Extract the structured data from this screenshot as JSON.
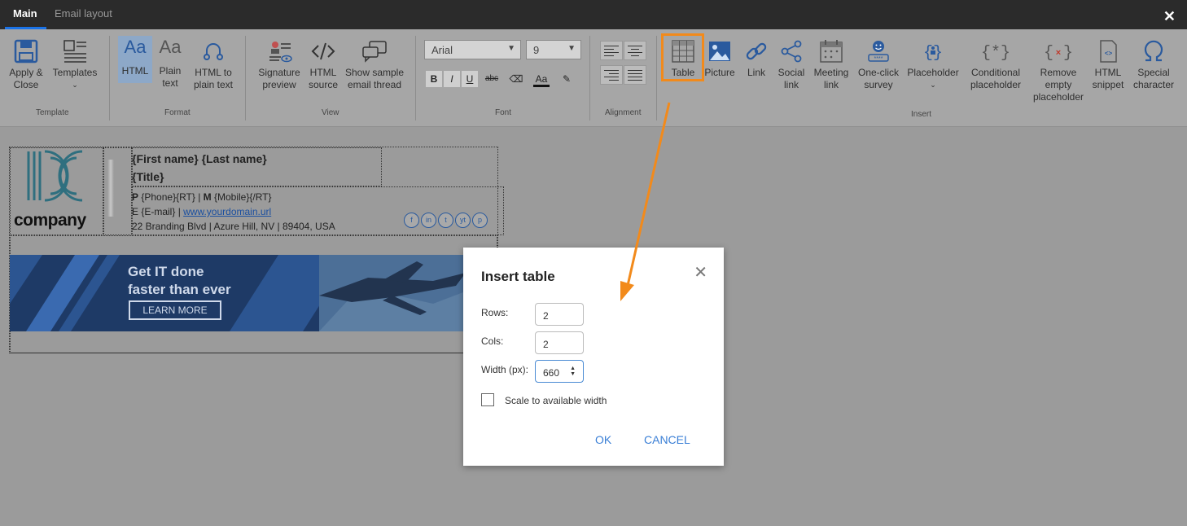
{
  "tabs": [
    {
      "label": "Main",
      "active": true
    },
    {
      "label": "Email layout",
      "active": false
    }
  ],
  "ribbon": {
    "groups": {
      "template": "Template",
      "format": "Format",
      "view": "View",
      "font": "Font",
      "alignment": "Alignment",
      "insert": "Insert"
    },
    "buttons": {
      "apply_close": [
        "Apply &",
        "Close"
      ],
      "templates": "Templates",
      "html": "HTML",
      "plain_text": [
        "Plain",
        "text"
      ],
      "html_to_plain": [
        "HTML to",
        "plain text"
      ],
      "signature_preview": [
        "Signature",
        "preview"
      ],
      "html_source": [
        "HTML",
        "source"
      ],
      "sample_thread": [
        "Show sample",
        "email thread"
      ],
      "table": "Table",
      "picture": "Picture",
      "link": "Link",
      "social_link": [
        "Social",
        "link"
      ],
      "meeting_link": [
        "Meeting",
        "link"
      ],
      "survey": [
        "One-click",
        "survey"
      ],
      "placeholder": "Placeholder",
      "conditional": [
        "Conditional",
        "placeholder"
      ],
      "remove_empty": [
        "Remove",
        "empty",
        "placeholder"
      ],
      "html_snippet": [
        "HTML",
        "snippet"
      ],
      "special_char": [
        "Special",
        "character"
      ]
    },
    "font": {
      "family": "Arial",
      "size": "9"
    },
    "format_buttons": [
      "B",
      "I",
      "U",
      "abc",
      "Aa"
    ]
  },
  "signature": {
    "name_line": "{First name} {Last name}",
    "title_line": "{Title}",
    "phone_prefix": "P",
    "phone_value": "{Phone}{RT} | ",
    "mobile_prefix": "M",
    "mobile_value": "{Mobile}{/RT}",
    "email_line": "E {E-mail} | ",
    "url": "www.yourdomain.url",
    "address": "22 Branding Blvd | Azure Hill, NV | 89404, USA",
    "logo_text": "company",
    "socials": [
      "f",
      "in",
      "t",
      "yt",
      "p"
    ],
    "banner": {
      "line1": "Get IT done",
      "line2": "faster than ever",
      "cta": "LEARN MORE"
    }
  },
  "dialog": {
    "title": "Insert table",
    "rows_label": "Rows:",
    "rows_value": "2",
    "cols_label": "Cols:",
    "cols_value": "2",
    "width_label": "Width (px):",
    "width_value": "660",
    "scale_label": "Scale to available width",
    "scale_checked": false,
    "ok": "OK",
    "cancel": "CANCEL"
  },
  "colors": {
    "accent": "#1a73e8",
    "highlight": "#f28a1b",
    "link": "#3a7fd6"
  }
}
